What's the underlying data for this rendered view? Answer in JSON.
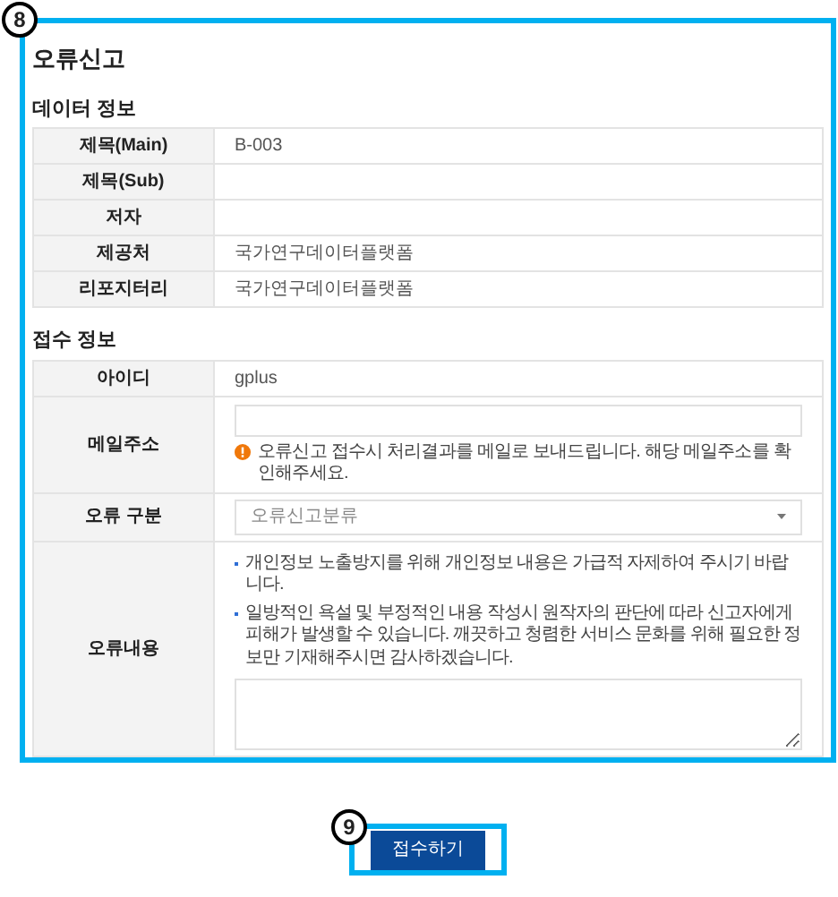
{
  "callouts": [
    "8",
    "9"
  ],
  "title": "오류신고",
  "data_info": {
    "heading": "데이터 정보",
    "rows": [
      {
        "label": "제목(Main)",
        "value": "B-003"
      },
      {
        "label": "제목(Sub)"
      },
      {
        "label": "저자"
      },
      {
        "label": "제공처",
        "value": "국가연구데이터플랫폼"
      },
      {
        "label": "리포지터리",
        "value": "국가연구데이터플랫폼"
      }
    ]
  },
  "receipt_info": {
    "heading": "접수 정보",
    "id": {
      "label": "아이디",
      "value": "gplus"
    },
    "email": {
      "label": "메일주소",
      "notice": "오류신고 접수시 처리결과를 메일로 보내드립니다. 해당 메일주소를 확인해주세요."
    },
    "error_type": {
      "label": "오류 구분",
      "placeholder": "오류신고분류"
    },
    "error_content": {
      "label": "오류내용",
      "guidelines": [
        "개인정보 노출방지를 위해 개인정보 내용은 가급적 자제하여 주시기 바랍니다.",
        "일방적인 욕설 및 부정적인 내용 작성시 원작자의 판단에 따라 신고자에게 피해가 발생할 수 있습니다. 깨끗하고 청렴한 서비스 문화를 위해 필요한 정보만 기재해주시면 감사하겠습니다."
      ]
    }
  },
  "submit_button": "접수하기"
}
